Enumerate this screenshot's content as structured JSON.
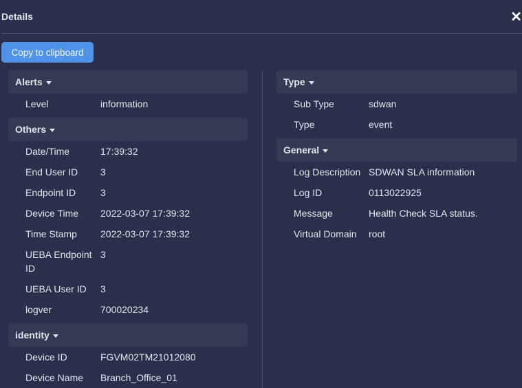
{
  "header": {
    "title": "Details",
    "close_icon": "close-icon"
  },
  "toolbar": {
    "copy_label": "Copy to clipboard"
  },
  "left": [
    {
      "title": "Alerts",
      "rows": [
        {
          "k": "Level",
          "v": "information"
        }
      ]
    },
    {
      "title": "Others",
      "rows": [
        {
          "k": "Date/Time",
          "v": "17:39:32"
        },
        {
          "k": "End User ID",
          "v": "3"
        },
        {
          "k": "Endpoint ID",
          "v": "3"
        },
        {
          "k": "Device Time",
          "v": "2022-03-07 17:39:32"
        },
        {
          "k": "Time Stamp",
          "v": "2022-03-07 17:39:32"
        },
        {
          "k": "UEBA Endpoint ID",
          "v": "3"
        },
        {
          "k": "UEBA User ID",
          "v": "3"
        },
        {
          "k": "logver",
          "v": "700020234"
        }
      ]
    },
    {
      "title": "identity",
      "rows": [
        {
          "k": "Device ID",
          "v": "FGVM02TM21012080"
        },
        {
          "k": "Device Name",
          "v": "Branch_Office_01"
        }
      ]
    }
  ],
  "right": [
    {
      "title": "Type",
      "rows": [
        {
          "k": "Sub Type",
          "v": "sdwan"
        },
        {
          "k": "Type",
          "v": "event"
        }
      ]
    },
    {
      "title": "General",
      "rows": [
        {
          "k": "Log Description",
          "v": "SDWAN SLA information"
        },
        {
          "k": "Log ID",
          "v": "0113022925"
        },
        {
          "k": "Message",
          "v": "Health Check SLA status."
        },
        {
          "k": "Virtual Domain",
          "v": "root"
        }
      ]
    }
  ]
}
